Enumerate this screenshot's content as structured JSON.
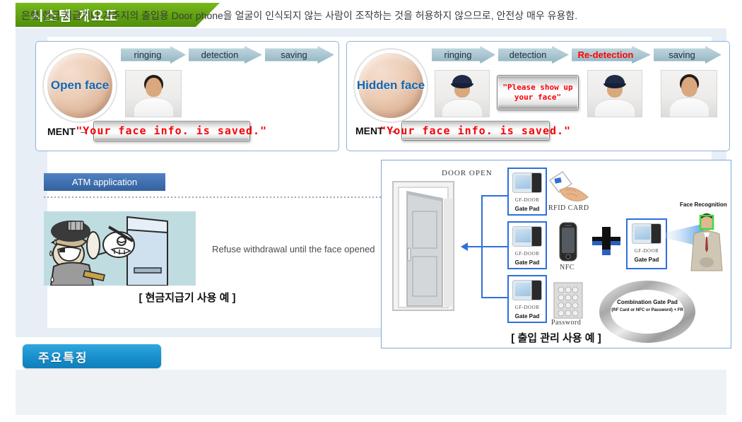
{
  "header": {
    "title": "시스템 개요도",
    "accent_color": "#63a513"
  },
  "flow_open": {
    "badge": "Open face",
    "steps": [
      {
        "label": "ringing",
        "alert": false
      },
      {
        "label": "detection",
        "alert": false
      },
      {
        "label": "saving",
        "alert": false
      }
    ],
    "ment_label": "MENT",
    "ment_arrow": "→",
    "ment_text": "\"Your face info. is saved.\""
  },
  "flow_hidden": {
    "badge": "Hidden face",
    "steps": [
      {
        "label": "ringing",
        "alert": false
      },
      {
        "label": "detection",
        "alert": false
      },
      {
        "label": "Re-detection",
        "alert": true
      },
      {
        "label": "saving",
        "alert": false
      }
    ],
    "prompt_line1": "\"Please show up",
    "prompt_line2": "your face\"",
    "ment_label": "MENT",
    "ment_arrow": "→",
    "ment_text": "\"Your face info. is saved.\""
  },
  "atm": {
    "chip_label": "ATM application",
    "note": "Refuse withdrawal until the face opened",
    "caption": "[ 현금지급기 사용 예 ]"
  },
  "door": {
    "door_open_label": "DOOR OPEN",
    "gate_pads": [
      {
        "model": "GF-DOOR",
        "name": "Gate Pad"
      },
      {
        "model": "GF-DOOR",
        "name": "Gate Pad"
      },
      {
        "model": "GF-DOOR",
        "name": "Gate Pad"
      }
    ],
    "combo_pad": {
      "model": "GF-DOOR",
      "name": "Gate Pad"
    },
    "credentials": [
      {
        "label": "RFID CARD"
      },
      {
        "label": "NFC"
      },
      {
        "label": "Password"
      }
    ],
    "plus_symbol": "+",
    "face_recognition_label": "Face Recognition",
    "ring_title": "Combination Gate Pad",
    "ring_subtitle": "(RF Card or NFC or Password) + FR",
    "caption": "[ 출입 관리 사용 예 ]"
  },
  "feature": {
    "banner_title": "주요특징",
    "accent_color": "#1a93cf",
    "text": "은행 현금 지급기나 거주지의 출입용 Door phone을 얼굴이 인식되지 않는 사람이 조작하는 것을 허용하지 않으므로, 안전상 매우 유용함."
  }
}
